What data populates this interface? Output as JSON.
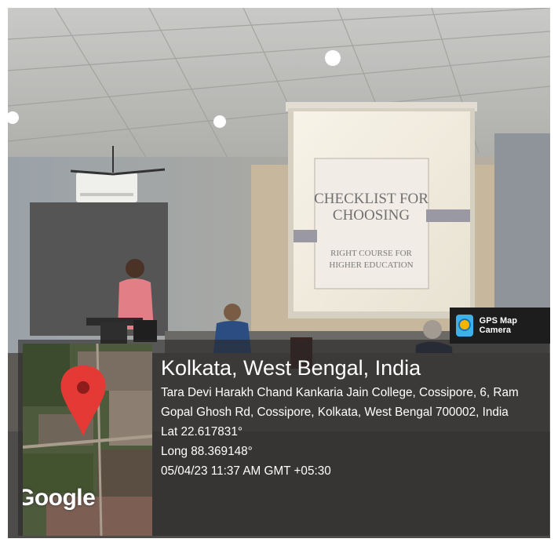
{
  "slide": {
    "title_line1": "CHECKLIST FOR",
    "title_line2": "CHOOSING",
    "subtitle_line1": "RIGHT COURSE FOR",
    "subtitle_line2": "HIGHER EDUCATION"
  },
  "badge": {
    "label": "GPS Map Camera",
    "icon": "gps-map-camera-icon"
  },
  "map": {
    "brand": "Google",
    "pin_icon": "map-pin-icon",
    "pin_color": "#e53935"
  },
  "location": {
    "title": "Kolkata, West Bengal, India",
    "address_line1": "Tara Devi Harakh Chand Kankaria Jain College, Cossipore, 6, Ram",
    "address_line2": "Gopal Ghosh Rd, Cossipore, Kolkata, West Bengal 700002, India",
    "lat": "Lat 22.617831°",
    "long": "Long 88.369148°",
    "datetime": "05/04/23 11:37 AM GMT +05:30"
  }
}
